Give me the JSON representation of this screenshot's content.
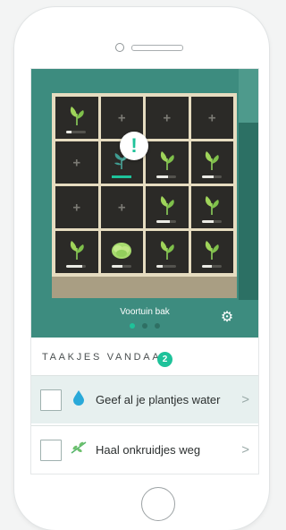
{
  "app": {
    "title": "Voortuin bak"
  },
  "garden": {
    "bed_name": "Voortuin bak",
    "alert_symbol": "!",
    "cells": [
      {
        "type": "plant",
        "icon": "leaf-plant-icon",
        "progress": 0.25
      },
      {
        "type": "empty",
        "symbol": "+"
      },
      {
        "type": "empty",
        "symbol": "+"
      },
      {
        "type": "empty",
        "symbol": "+"
      },
      {
        "type": "empty",
        "symbol": "+"
      },
      {
        "type": "plant",
        "icon": "sprout-plant-icon",
        "progress": 1.0,
        "selected": true
      },
      {
        "type": "plant",
        "icon": "leaf-plant-icon",
        "progress": 0.6
      },
      {
        "type": "plant",
        "icon": "leaf-plant-icon",
        "progress": 0.6
      },
      {
        "type": "empty",
        "symbol": "+"
      },
      {
        "type": "empty",
        "symbol": "+"
      },
      {
        "type": "plant",
        "icon": "leaf-plant-icon",
        "progress": 0.7
      },
      {
        "type": "plant",
        "icon": "leaf-plant-icon",
        "progress": 0.6
      },
      {
        "type": "plant",
        "icon": "leaf-plant-icon",
        "progress": 0.8
      },
      {
        "type": "plant",
        "icon": "lettuce-plant-icon",
        "progress": 0.55
      },
      {
        "type": "plant",
        "icon": "leaf-plant-icon",
        "progress": 0.3
      },
      {
        "type": "plant",
        "icon": "leaf-plant-icon",
        "progress": 0.5
      }
    ],
    "page_dots": 3,
    "active_dot": 0
  },
  "tasks": {
    "heading": "TAAKJES VANDAAG",
    "count": "2",
    "items": [
      {
        "label": "Geef al je plantjes water",
        "icon": "water-drop-icon",
        "arrow": ">"
      },
      {
        "label": "Haal onkruidjes weg",
        "icon": "weed-icon",
        "arrow": ">"
      }
    ]
  },
  "colors": {
    "accent": "#1ec29a",
    "hero": "#3d8c7f",
    "soil": "#2b2a27"
  }
}
